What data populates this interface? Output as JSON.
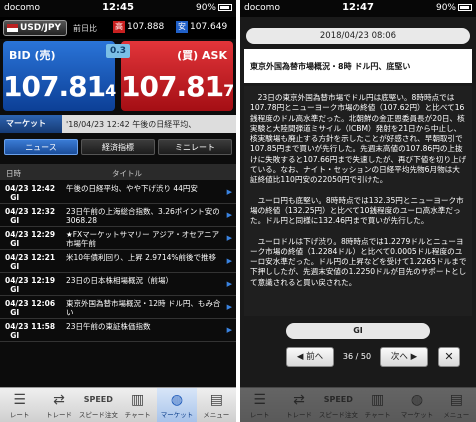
{
  "left": {
    "status": {
      "carrier": "docomo",
      "time": "12:45",
      "battery": "90%"
    },
    "pair": {
      "label": "USD/JPY",
      "prev_label": "前日比",
      "high_tag": "高",
      "high_value": "107.888",
      "low_tag": "安",
      "low_value": "107.649"
    },
    "bid": {
      "label": "BID (売)",
      "main": "107.81",
      "tail": "4"
    },
    "ask": {
      "label": "(買) ASK",
      "main": "107.81",
      "tail": "7"
    },
    "spread": "0.3",
    "market": {
      "label": "マーケット",
      "ticker": "'18/04/23 12:42 午後の日経平均、"
    },
    "tabs": [
      "ニュース",
      "経済指標",
      "ミニレート"
    ],
    "table_headers": {
      "date": "日時",
      "title": "タイトル"
    },
    "news": [
      {
        "date": "04/23 12:42",
        "src": "GI",
        "title": "午後の日経平均、やや下げ渋り 44円安"
      },
      {
        "date": "04/23 12:32",
        "src": "GI",
        "title": "23日午前の上海総合指数、3.26ポイント安の3068.28"
      },
      {
        "date": "04/23 12:29",
        "src": "GI",
        "title": "★FXマーケットサマリー アジア・オセアニア市場午前"
      },
      {
        "date": "04/23 12:21",
        "src": "GI",
        "title": "米10年債利回り、上昇 2.9714%前後で推移"
      },
      {
        "date": "04/23 12:19",
        "src": "GI",
        "title": "23日の日本株相場概況（前場）"
      },
      {
        "date": "04/23 12:06",
        "src": "GI",
        "title": "東京外国為替市場概況・12時 ドル円、もみ合い"
      },
      {
        "date": "04/23 11:58",
        "src": "GI",
        "title": "23日午前の東証株価指数"
      }
    ],
    "nav": [
      "レート",
      "トレード",
      "スピード注文",
      "チャート",
      "マーケット",
      "メニュー"
    ]
  },
  "right": {
    "status": {
      "carrier": "docomo",
      "time": "12:47",
      "battery": "90%"
    },
    "date": "2018/04/23 08:06",
    "headline": "東京外国為替市場概況・8時 ドル円、底堅い",
    "paragraphs": [
      "23日の東京外国為替市場でドル円は底堅い。8時時点では107.78円とニューヨーク市場の終値（107.62円）と比べて16銭程度のドル高水準だった。北朝鮮の金正恩委員長が20日、核実験と大陸間弾道ミサイル（ICBM）発射を21日から中止し、核実験場も廃止する方針を示したことが好感され、早朝取引で107.85円まで買いが先行した。先週末高値の107.86円の上抜けに失敗すると107.66円まで失速したが、再び下値を切り上げている。なお、ナイト・セッションの日経平均先物6月物は大証終値比110円安の22050円で引けた。",
      "ユーロ円も底堅い。8時時点では132.35円とニューヨーク市場の終値（132.25円）と比べて10銭程度のユーロ高水準だった。ドル円と同様に132.46円まで買いが先行した。",
      "ユーロドルは下げ渋り。8時時点では1.2279ドルとニューヨーク市場の終値（1.2284ドル）と比べて0.0005ドル程度のユーロ安水準だった。ドル円の上昇などを受けて1.2265ドルまで下押ししたが、先週末安値の1.2250ドルが目先のサポートとして意識されると買い戻された。"
    ],
    "source": "GI",
    "prev": "◀ 前へ",
    "next": "次へ ▶",
    "count": "36 / 50",
    "close": "✕"
  }
}
